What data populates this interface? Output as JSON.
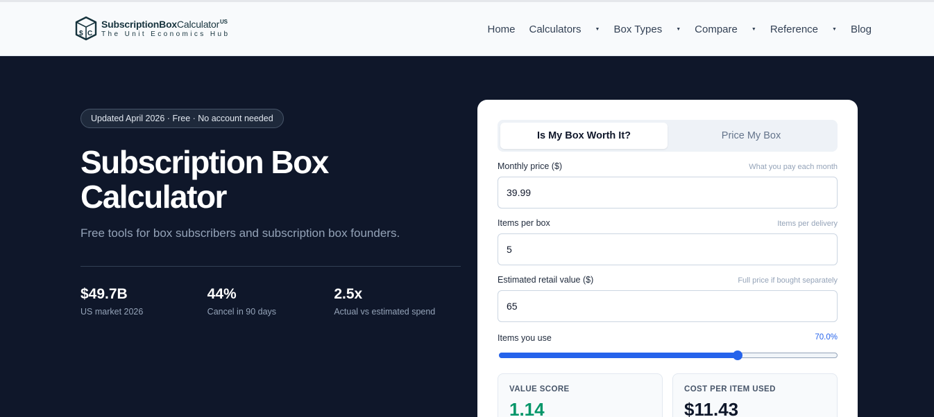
{
  "header": {
    "brand_bold": "SubscriptionBox",
    "brand_light": "Calculator",
    "brand_badge": "US",
    "tagline": "The Unit Economics Hub",
    "logo_icon": "box-dollar-icon",
    "nav": [
      {
        "label": "Home",
        "dropdown": false
      },
      {
        "label": "Calculators",
        "dropdown": true
      },
      {
        "label": "Box Types",
        "dropdown": true
      },
      {
        "label": "Compare",
        "dropdown": true
      },
      {
        "label": "Reference",
        "dropdown": true
      },
      {
        "label": "Blog",
        "dropdown": false
      }
    ],
    "caret": "▼"
  },
  "hero": {
    "badge": "Updated April 2026 · Free · No account needed",
    "title_line1": "Subscription Box",
    "title_line2": "Calculator",
    "subtitle": "Free tools for box subscribers and subscription box founders.",
    "stats": [
      {
        "value": "$49.7B",
        "label": "US market 2026"
      },
      {
        "value": "44%",
        "label": "Cancel in 90 days"
      },
      {
        "value": "2.5x",
        "label": "Actual vs estimated spend"
      }
    ]
  },
  "calculator": {
    "tabs": [
      {
        "label": "Is My Box Worth It?",
        "active": true
      },
      {
        "label": "Price My Box",
        "active": false
      }
    ],
    "fields": [
      {
        "label": "Monthly price ($)",
        "hint": "What you pay each month",
        "value": "39.99"
      },
      {
        "label": "Items per box",
        "hint": "Items per delivery",
        "value": "5"
      },
      {
        "label": "Estimated retail value ($)",
        "hint": "Full price if bought separately",
        "value": "65"
      }
    ],
    "slider": {
      "label": "Items you use",
      "value_text": "70.0%",
      "fraction": 0.7
    },
    "results": [
      {
        "label": "VALUE SCORE",
        "value": "1.14"
      },
      {
        "label": "COST PER ITEM USED",
        "value": "$11.43"
      }
    ]
  },
  "colors": {
    "accent": "#2563eb",
    "hero_bg": "#0f172a",
    "brand": "#16333d",
    "positive": "#059669"
  }
}
